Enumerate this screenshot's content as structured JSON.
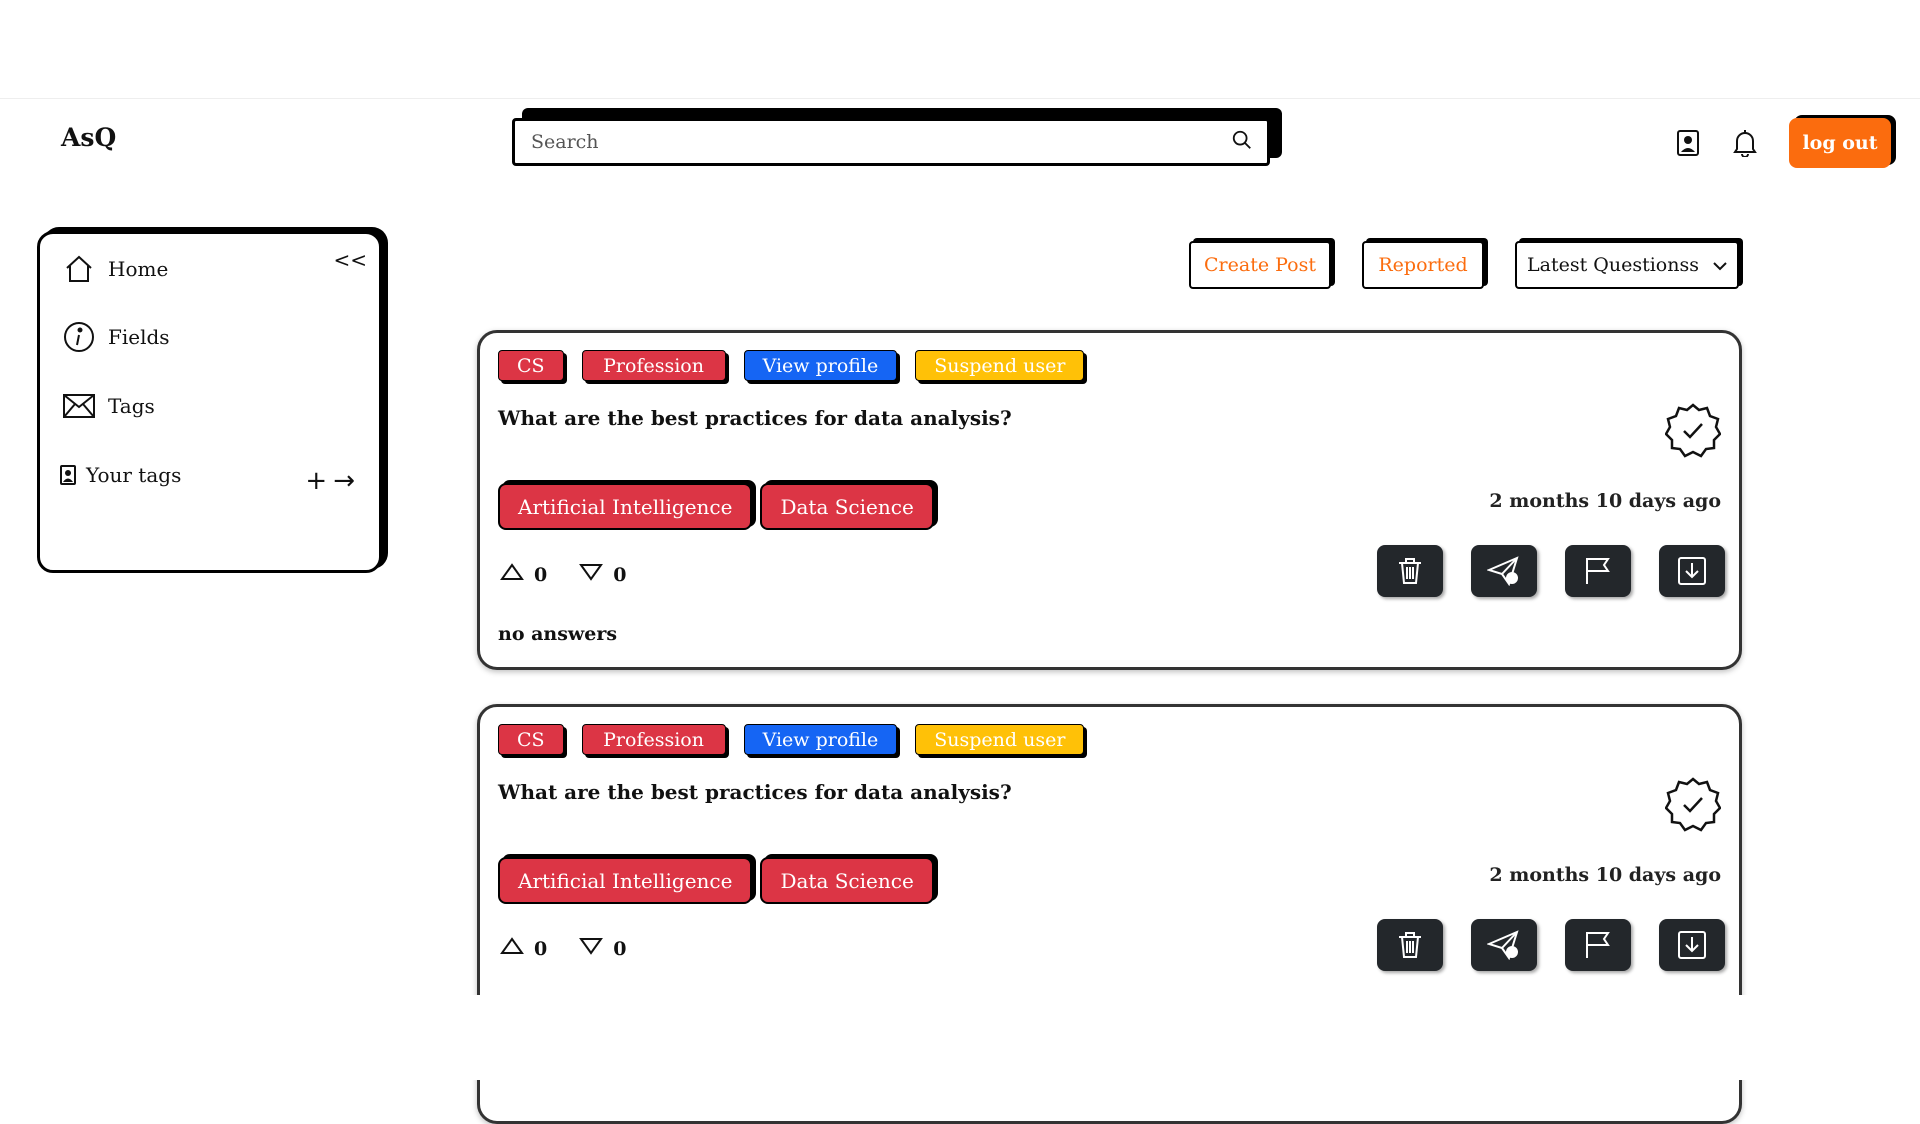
{
  "header": {
    "logo": "AsQ",
    "search_placeholder": "Search",
    "logout_label": "log out"
  },
  "sidebar": {
    "collapse_label": "<<",
    "items": [
      {
        "label": "Home",
        "icon": "home-icon"
      },
      {
        "label": "Fields",
        "icon": "info-icon"
      },
      {
        "label": "Tags",
        "icon": "envelope-icon"
      },
      {
        "label": "Your tags",
        "icon": "contact-icon"
      }
    ],
    "add_label": "+",
    "go_label": "→"
  },
  "toolbar": {
    "create_post": "Create Post",
    "reported": "Reported",
    "sort_selected": "Latest Questionss"
  },
  "colors": {
    "accent": "#fb6c0e",
    "chip_red": "#dc3545",
    "chip_blue": "#1565f4",
    "chip_yellow": "#ffc107",
    "action_bg": "#23272b"
  },
  "posts": [
    {
      "chips": [
        "CS",
        "Profession",
        "View profile",
        "Suspend user"
      ],
      "question": "What are the best practices for data analysis?",
      "tags": [
        "Artificial Intelligence",
        "Data Science"
      ],
      "time_ago": "2 months 10 days ago",
      "upvotes": "0",
      "downvotes": "0",
      "answers": "no answers"
    },
    {
      "chips": [
        "CS",
        "Profession",
        "View profile",
        "Suspend user"
      ],
      "question": "What are the best practices for data analysis?",
      "tags": [
        "Artificial Intelligence",
        "Data Science"
      ],
      "time_ago": "2 months 10 days ago",
      "upvotes": "0",
      "downvotes": "0"
    }
  ]
}
